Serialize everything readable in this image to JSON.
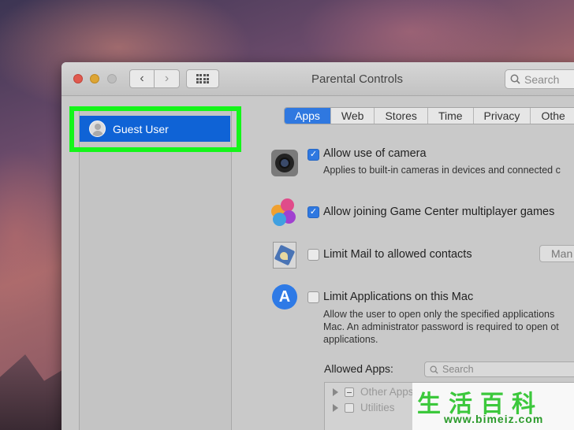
{
  "window": {
    "title": "Parental Controls",
    "search_placeholder": "Search"
  },
  "sidebar": {
    "users": [
      {
        "label": "Guest User",
        "selected": true
      }
    ],
    "highlight_color": "#14f51a"
  },
  "tabs": [
    {
      "label": "Apps",
      "active": true
    },
    {
      "label": "Web"
    },
    {
      "label": "Stores"
    },
    {
      "label": "Time"
    },
    {
      "label": "Privacy"
    },
    {
      "label": "Othe"
    }
  ],
  "options": {
    "camera": {
      "label": "Allow use of camera",
      "desc": "Applies to built-in cameras in devices and connected c",
      "checked": true,
      "icon": "camera-icon"
    },
    "game_center": {
      "label": "Allow joining Game Center multiplayer games",
      "checked": true,
      "icon": "game-center-icon"
    },
    "mail": {
      "label": "Limit Mail to allowed contacts",
      "button": "Man",
      "checked": false,
      "icon": "mail-stamp-icon"
    },
    "applications": {
      "label": "Limit Applications on this Mac",
      "desc_lines": [
        "Allow the user to open only the specified applications",
        "Mac. An administrator password is required to open ot",
        "applications."
      ],
      "checked": false,
      "icon": "app-store-icon"
    }
  },
  "allowed_apps": {
    "label": "Allowed Apps:",
    "search_placeholder": "Search",
    "rows": [
      {
        "label": "Other Apps"
      },
      {
        "label": "Utilities"
      }
    ]
  },
  "watermark": {
    "chars": [
      "生",
      "活",
      "百",
      "科"
    ],
    "url": "www.bimeiz.com"
  },
  "colors": {
    "accent": "#2f78e0",
    "selection": "#0f63d6"
  }
}
